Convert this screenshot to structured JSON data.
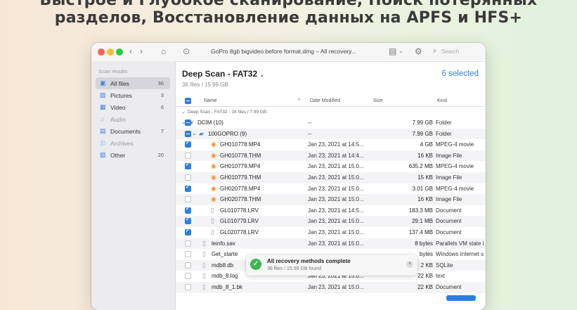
{
  "headline": {
    "line1": "Быстрое и Глубокое сканирование, Поиск потерянных",
    "line2": "разделов, Восстановление данных на APFS и HFS+"
  },
  "window": {
    "title": "GoPro 8gb bigvideo before format.dmg – All recovery...",
    "search_placeholder": "Search"
  },
  "sidebar": {
    "heading": "Scan results",
    "items": [
      {
        "label": "All files",
        "count": "36",
        "icon": "all-files-icon"
      },
      {
        "label": "Pictures",
        "count": "3",
        "icon": "pictures-icon"
      },
      {
        "label": "Video",
        "count": "6",
        "icon": "video-icon"
      },
      {
        "label": "Audio",
        "count": "",
        "icon": "audio-icon"
      },
      {
        "label": "Documents",
        "count": "7",
        "icon": "documents-icon"
      },
      {
        "label": "Archives",
        "count": "",
        "icon": "archives-icon"
      },
      {
        "label": "Other",
        "count": "20",
        "icon": "other-icon"
      }
    ]
  },
  "main": {
    "scan_title": "Deep Scan - FAT32",
    "scan_subtitle": "36 files / 15.99 GB",
    "selected": "6 selected",
    "columns": {
      "name": "Name",
      "date": "Date Modified",
      "size": "Size",
      "kind": "Kind"
    },
    "group": "Deep Scan - FAT32 · 16 files / 7.99 GB",
    "rows": [
      {
        "name": "DCIM (10)",
        "date": "--",
        "size": "7.99 GB",
        "kind": "Folder"
      },
      {
        "name": "100GOPRO (9)",
        "date": "--",
        "size": "7.99 GB",
        "kind": "Folder"
      },
      {
        "name": "GH010778.MP4",
        "date": "Jan 23, 2021 at 14:5...",
        "size": "4 GB",
        "kind": "MPEG-4 movie"
      },
      {
        "name": "GH010778.THM",
        "date": "Jan 23, 2021 at 14:4...",
        "size": "16 KB",
        "kind": "Image File"
      },
      {
        "name": "GH010779.MP4",
        "date": "Jan 23, 2021 at 15:0...",
        "size": "635.2 MB",
        "kind": "MPEG-4 movie"
      },
      {
        "name": "GH010779.THM",
        "date": "Jan 23, 2021 at 15:0...",
        "size": "15 KB",
        "kind": "Image File"
      },
      {
        "name": "GH020778.MP4",
        "date": "Jan 23, 2021 at 15:0...",
        "size": "3.01 GB",
        "kind": "MPEG-4 movie"
      },
      {
        "name": "GH020778.THM",
        "date": "Jan 23, 2021 at 15:0...",
        "size": "16 KB",
        "kind": "Image File"
      },
      {
        "name": "GL010778.LRV",
        "date": "Jan 23, 2021 at 14:5...",
        "size": "183.3 MB",
        "kind": "Document"
      },
      {
        "name": "GL010779.LRV",
        "date": "Jan 23, 2021 at 15:0...",
        "size": "29.1 MB",
        "kind": "Document"
      },
      {
        "name": "GL020778.LRV",
        "date": "Jan 23, 2021 at 15:0...",
        "size": "137.4 MB",
        "kind": "Document"
      },
      {
        "name": "leinfo.sav",
        "date": "Jan 23, 2021 at 15:0...",
        "size": "8 bytes",
        "kind": "Parallels VM state i"
      },
      {
        "name": "Get_starte",
        "date": "",
        "size": "bytes",
        "kind": "Windows Internet s"
      },
      {
        "name": "mdb8.db",
        "date": "",
        "size": "2 KB",
        "kind": "SQLite"
      },
      {
        "name": "mdb_8.log",
        "date": "Jan 23, 2021 at 15:0...",
        "size": "22 KB",
        "kind": "text"
      },
      {
        "name": "mdb_8_1.bk",
        "date": "Jan 23, 2021 at 15:0...",
        "size": "22 KB",
        "kind": "Document"
      }
    ]
  },
  "toast": {
    "title": "All recovery methods complete",
    "subtitle": "36 files / 15.99 GB found"
  },
  "colors": {
    "accent": "#2b7fe0",
    "selected_text": "#2b86d9",
    "success": "#3cb64c"
  }
}
